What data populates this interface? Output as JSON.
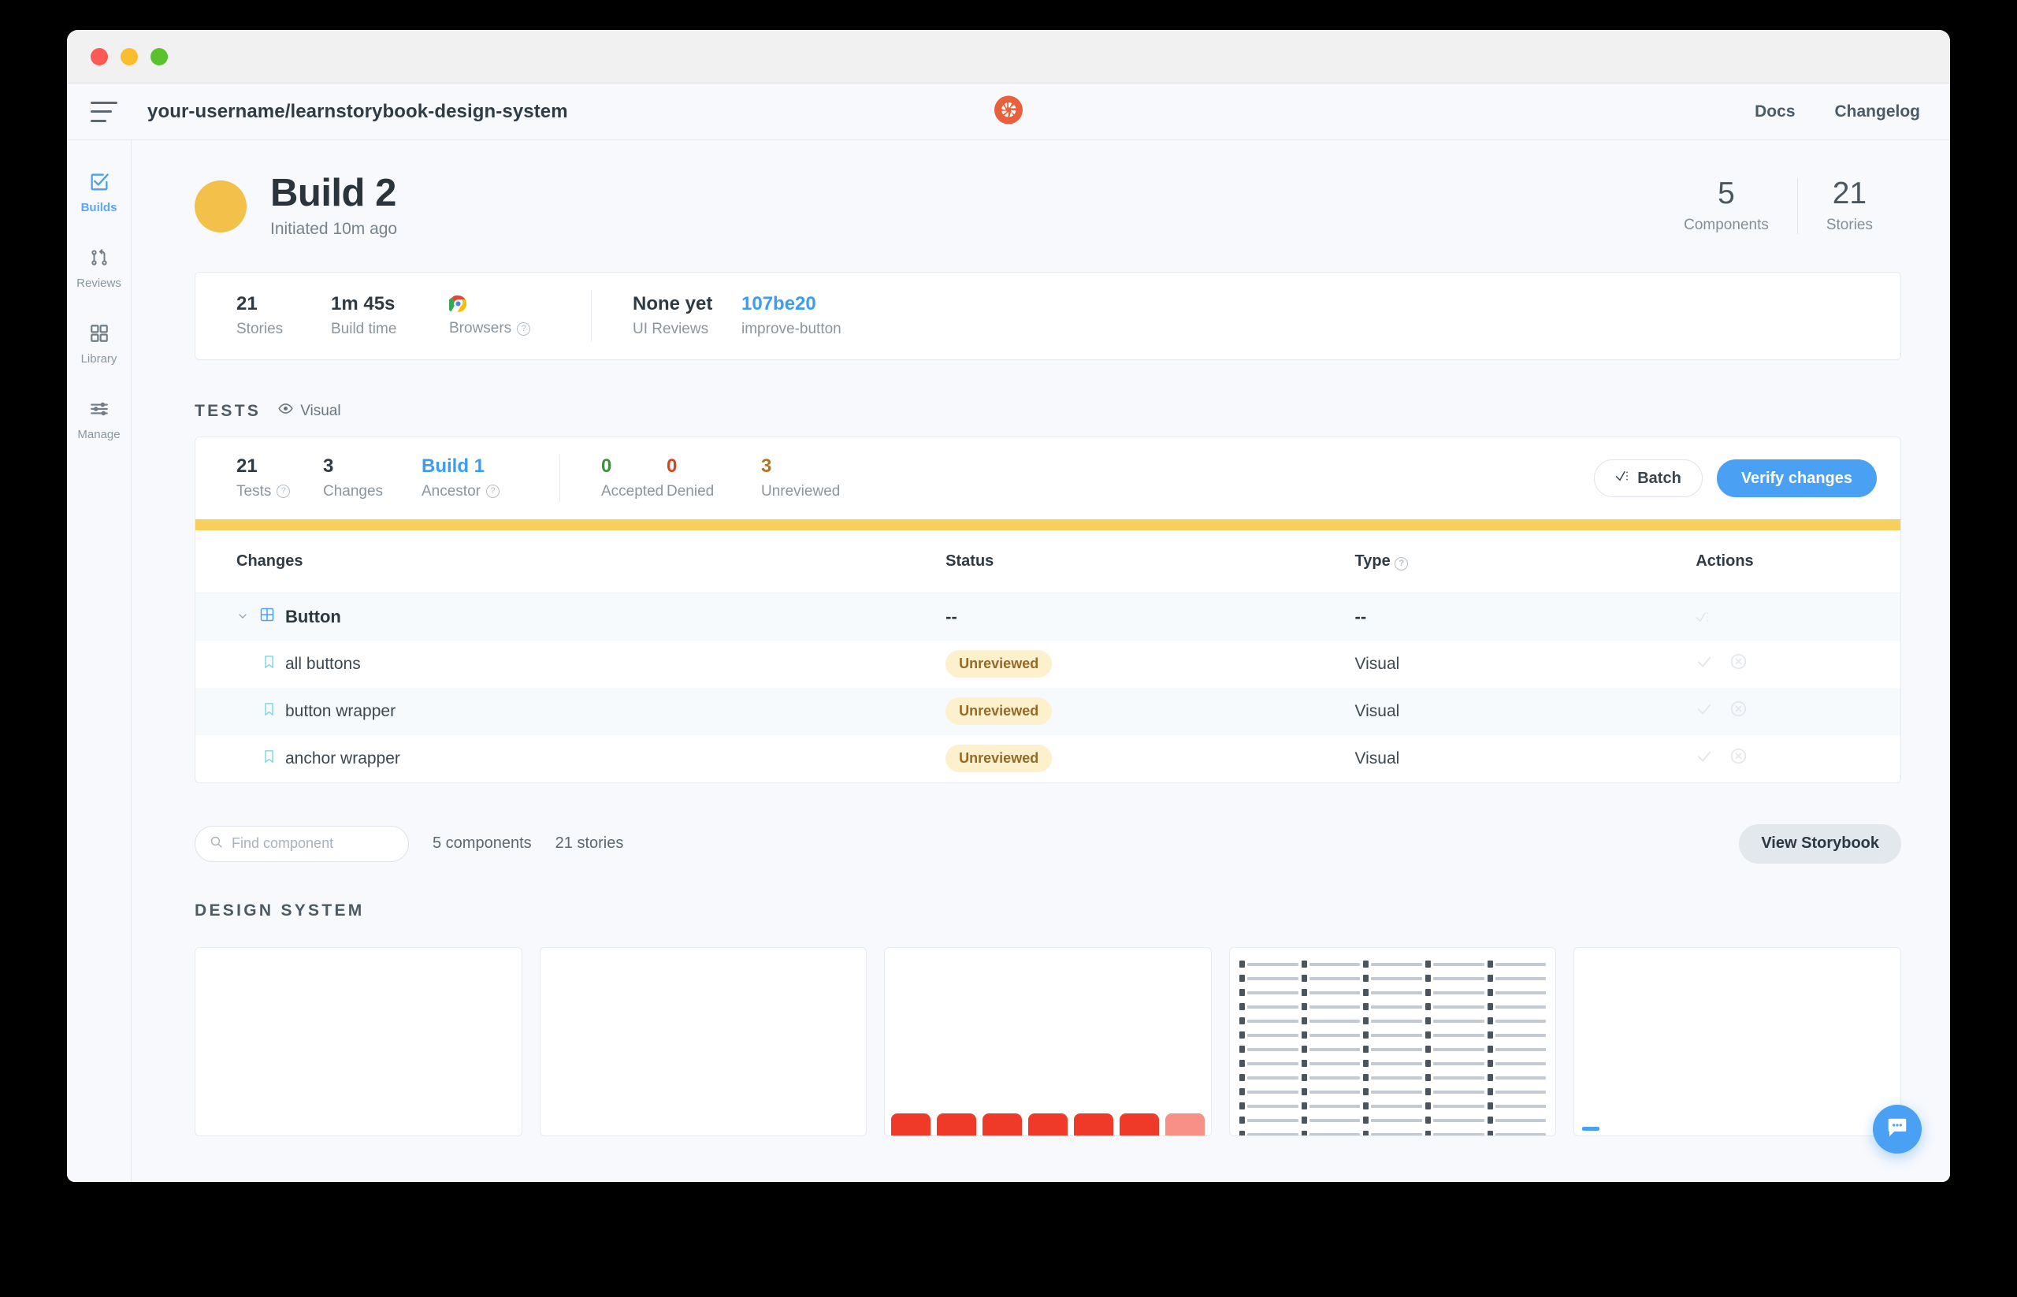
{
  "window": {
    "traffic_lights": [
      "close",
      "minimize",
      "maximize"
    ]
  },
  "header": {
    "menu_icon": "hamburger-icon",
    "repo_path": "your-username/learnstorybook-design-system",
    "logo": "chromatic-logo",
    "links": [
      {
        "label": "Docs"
      },
      {
        "label": "Changelog"
      }
    ]
  },
  "sidebar": {
    "items": [
      {
        "label": "Builds",
        "icon": "checkbox-check-icon",
        "active": true
      },
      {
        "label": "Reviews",
        "icon": "pull-request-icon",
        "active": false
      },
      {
        "label": "Library",
        "icon": "grid-squares-icon",
        "active": false
      },
      {
        "label": "Manage",
        "icon": "sliders-icon",
        "active": false
      }
    ]
  },
  "hero": {
    "avatar_color": "#f3c14a",
    "title": "Build 2",
    "subtitle": "Initiated 10m ago",
    "stats": [
      {
        "value": "5",
        "label": "Components"
      },
      {
        "value": "21",
        "label": "Stories"
      }
    ]
  },
  "summary": {
    "stats": [
      {
        "value": "21",
        "label": "Stories",
        "help": false,
        "link": false
      },
      {
        "value": "1m 45s",
        "label": "Build time",
        "help": false,
        "link": false
      },
      {
        "value": "",
        "label": "Browsers",
        "help": true,
        "link": false,
        "icon": "chrome-icon"
      },
      {
        "value": "None yet",
        "label": "UI Reviews",
        "help": false,
        "link": false
      },
      {
        "value": "107be20",
        "label": "improve-button",
        "help": false,
        "link": true
      }
    ]
  },
  "tests": {
    "heading": "TESTS",
    "filter_label": "Visual",
    "filter_icon": "eye-icon",
    "stats": [
      {
        "value": "21",
        "label": "Tests",
        "help": true,
        "color": "#2e3a43"
      },
      {
        "value": "3",
        "label": "Changes",
        "help": false,
        "color": "#2e3a43"
      },
      {
        "value": "Build 1",
        "label": "Ancestor",
        "help": true,
        "color": "#3c9cf5"
      },
      {
        "value": "0",
        "label": "Accepted",
        "help": false,
        "color": "#3f8f3f"
      },
      {
        "value": "0",
        "label": "Denied",
        "help": false,
        "color": "#d6451f"
      },
      {
        "value": "3",
        "label": "Unreviewed",
        "help": false,
        "color": "#b3741c"
      }
    ],
    "batch_button": "Batch",
    "verify_button": "Verify changes",
    "strip_color": "#f6cf5c",
    "columns": [
      "Changes",
      "Status",
      "Type",
      "Actions"
    ],
    "type_header_help": true,
    "rows": [
      {
        "kind": "group",
        "icon": "component-grid-icon",
        "expanded": true,
        "name": "Button",
        "status": "--",
        "type": "--",
        "actions": "batch-icon"
      },
      {
        "kind": "story",
        "icon": "bookmark-icon",
        "name": "all buttons",
        "status": "Unreviewed",
        "type": "Visual"
      },
      {
        "kind": "story",
        "icon": "bookmark-icon",
        "name": "button wrapper",
        "status": "Unreviewed",
        "type": "Visual"
      },
      {
        "kind": "story",
        "icon": "bookmark-icon",
        "name": "anchor wrapper",
        "status": "Unreviewed",
        "type": "Visual"
      }
    ],
    "row_actions": {
      "accept": "check-icon",
      "deny": "x-circle-icon"
    }
  },
  "find": {
    "placeholder": "Find component",
    "value": "",
    "search_icon": "search-icon",
    "components_count": "5 components",
    "stories_count": "21 stories",
    "storybook_button": "View Storybook"
  },
  "design_system": {
    "heading": "DESIGN SYSTEM",
    "thumbnails": [
      {
        "kind": "blank"
      },
      {
        "kind": "blank"
      },
      {
        "kind": "buttons"
      },
      {
        "kind": "icons"
      },
      {
        "kind": "link"
      }
    ]
  },
  "chat": {
    "icon": "chat-bubble-icon",
    "color": "#4aa1f3"
  }
}
